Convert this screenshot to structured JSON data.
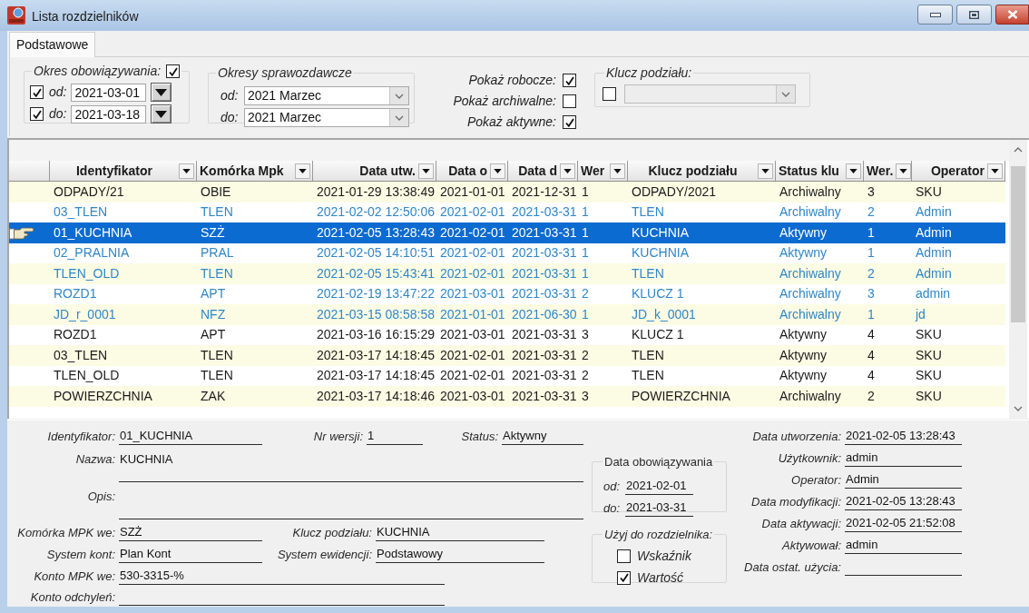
{
  "window": {
    "title": "Lista rozdzielników"
  },
  "tabs": [
    {
      "label": "Podstawowe",
      "selected": true
    }
  ],
  "filters": {
    "validity_period": {
      "label": "Okres obowiązywania:",
      "checked": true,
      "from": {
        "label": "od:",
        "checked": true,
        "value": "2021-03-01"
      },
      "to": {
        "label": "do:",
        "checked": true,
        "value": "2021-03-18"
      }
    },
    "reporting_periods": {
      "label": "Okresy sprawozdawcze",
      "from": {
        "label": "od:",
        "value": "2021 Marzec"
      },
      "to": {
        "label": "do:",
        "value": "2021 Marzec"
      }
    },
    "show_options": [
      {
        "label": "Pokaż robocze:",
        "checked": true
      },
      {
        "label": "Pokaż archiwalne:",
        "checked": false
      },
      {
        "label": "Pokaż aktywne:",
        "checked": true
      }
    ],
    "split_key": {
      "label": "Klucz podziału:",
      "checked": false,
      "disabled": true
    }
  },
  "table": {
    "columns": [
      "Identyfikator",
      "Komórka Mpk",
      "Data utw.",
      "Data o",
      "Data d",
      "Wer",
      "Klucz podziału",
      "Status klu",
      "Wer.",
      "Operator"
    ],
    "rows": [
      {
        "selected": false,
        "highlighted": false,
        "cells": [
          "ODPADY/21",
          "OBIE",
          "2021-01-29 13:38:49",
          "2021-01-01",
          "2021-12-31",
          "1",
          "ODPADY/2021",
          "Archiwalny",
          "3",
          "SKU"
        ]
      },
      {
        "selected": false,
        "highlighted": true,
        "cells": [
          "03_TLEN",
          "TLEN",
          "2021-02-02 12:50:06",
          "2021-02-01",
          "2021-03-31",
          "1",
          "TLEN",
          "Archiwalny",
          "2",
          "Admin"
        ]
      },
      {
        "selected": true,
        "cells": [
          "01_KUCHNIA",
          "SZŻ",
          "2021-02-05 13:28:43",
          "2021-02-01",
          "2021-03-31",
          "1",
          "KUCHNIA",
          "Aktywny",
          "1",
          "Admin"
        ]
      },
      {
        "selected": false,
        "highlighted": true,
        "cells": [
          "02_PRALNIA",
          "PRAL",
          "2021-02-05 14:10:51",
          "2021-02-01",
          "2021-03-31",
          "1",
          "KUCHNIA",
          "Aktywny",
          "1",
          "Admin"
        ]
      },
      {
        "selected": false,
        "highlighted": true,
        "cells": [
          "TLEN_OLD",
          "TLEN",
          "2021-02-05 15:43:41",
          "2021-02-01",
          "2021-03-31",
          "1",
          "TLEN",
          "Archiwalny",
          "2",
          "Admin"
        ]
      },
      {
        "selected": false,
        "highlighted": true,
        "cells": [
          "ROZD1",
          "APT",
          "2021-02-19 13:47:22",
          "2021-03-01",
          "2021-03-31",
          "2",
          "KLUCZ 1",
          "Archiwalny",
          "3",
          "admin"
        ]
      },
      {
        "selected": false,
        "highlighted": true,
        "cells": [
          "JD_r_0001",
          "NFZ",
          "2021-03-15 08:58:58",
          "2021-01-01",
          "2021-06-30",
          "1",
          "JD_k_0001",
          "Archiwalny",
          "1",
          "jd"
        ]
      },
      {
        "selected": false,
        "highlighted": false,
        "cells": [
          "ROZD1",
          "APT",
          "2021-03-16 16:15:29",
          "2021-03-01",
          "2021-03-31",
          "3",
          "KLUCZ 1",
          "Aktywny",
          "4",
          "SKU"
        ]
      },
      {
        "selected": false,
        "highlighted": false,
        "cells": [
          "03_TLEN",
          "TLEN",
          "2021-03-17 14:18:45",
          "2021-02-01",
          "2021-03-31",
          "2",
          "TLEN",
          "Aktywny",
          "4",
          "SKU"
        ]
      },
      {
        "selected": false,
        "highlighted": false,
        "cells": [
          "TLEN_OLD",
          "TLEN",
          "2021-03-17 14:18:45",
          "2021-02-01",
          "2021-03-31",
          "2",
          "TLEN",
          "Aktywny",
          "4",
          "SKU"
        ]
      },
      {
        "selected": false,
        "highlighted": false,
        "cells": [
          "POWIERZCHNIA",
          "ZAK",
          "2021-03-17 14:18:46",
          "2021-03-01",
          "2021-03-31",
          "3",
          "POWIERZCHNIA",
          "Archiwalny",
          "2",
          "SKU"
        ]
      }
    ]
  },
  "details": {
    "identifier": {
      "label": "Identyfikator:",
      "value": "01_KUCHNIA"
    },
    "version": {
      "label": "Nr wersji:",
      "value": "1"
    },
    "status": {
      "label": "Status:",
      "value": "Aktywny"
    },
    "name": {
      "label": "Nazwa:",
      "value": "KUCHNIA"
    },
    "description": {
      "label": "Opis:"
    },
    "mpk_cell": {
      "label": "Komórka MPK we:",
      "value": "SZŻ"
    },
    "split_key": {
      "label": "Klucz podziału:",
      "value": "KUCHNIA"
    },
    "account_system": {
      "label": "System kont:",
      "value": "Plan Kont"
    },
    "record_system": {
      "label": "System ewidencji:",
      "value": "Podstawowy"
    },
    "mpk_account": {
      "label": "Konto MPK we:",
      "value": "530-3315-%"
    },
    "deviation_account": {
      "label": "Konto odchyleń:"
    },
    "validity": {
      "title": "Data obowiązywania",
      "from": {
        "label": "od:",
        "value": "2021-02-01"
      },
      "to": {
        "label": "do:",
        "value": "2021-03-31"
      }
    },
    "use_for": {
      "title": "Użyj do rozdzielnika:",
      "options": [
        {
          "label": "Wskaźnik",
          "checked": false
        },
        {
          "label": "Wartość",
          "checked": true
        }
      ]
    },
    "audit": [
      {
        "label": "Data utworzenia:",
        "value": "2021-02-05 13:28:43"
      },
      {
        "label": "Użytkownik:",
        "value": "admin"
      },
      {
        "label": "Operator:",
        "value": "Admin"
      },
      {
        "label": "Data modyfikacji:",
        "value": "2021-02-05 13:28:43"
      },
      {
        "label": "Data aktywacji:",
        "value": "2021-02-05 21:52:08"
      },
      {
        "label": "Aktywował:",
        "value": "admin"
      },
      {
        "label": "Data ostat. użycia:"
      }
    ]
  }
}
